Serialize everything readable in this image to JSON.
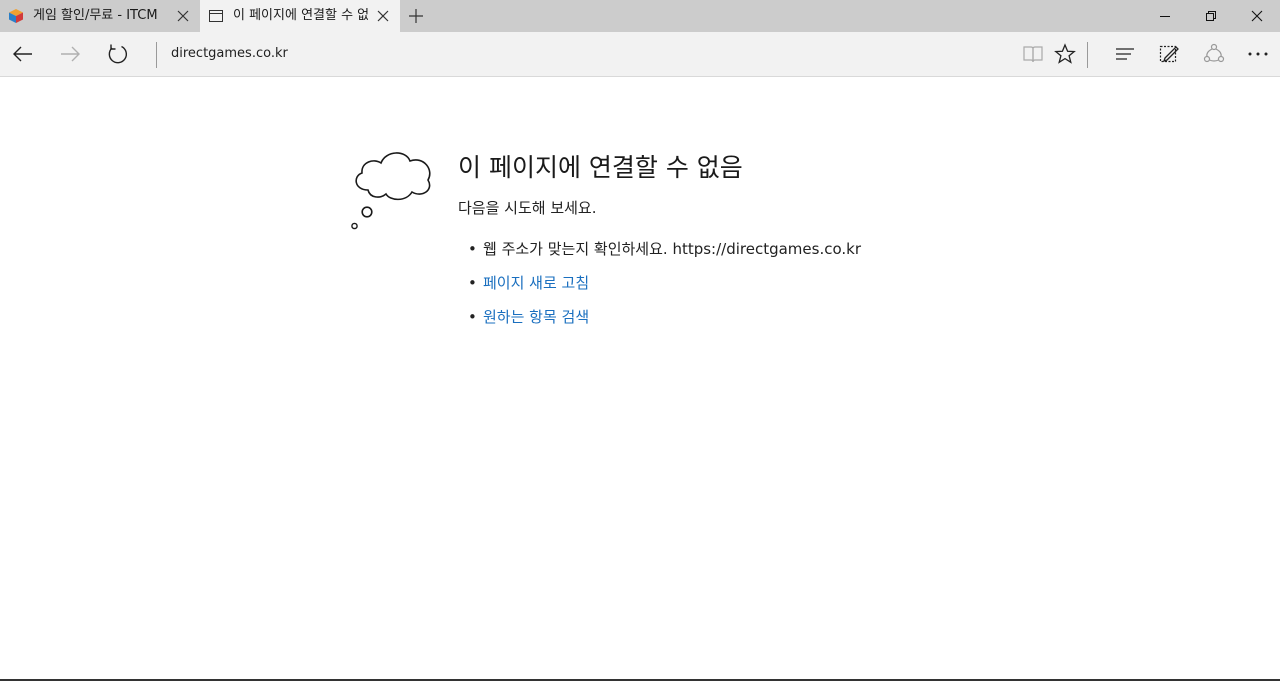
{
  "tabs": [
    {
      "title": "게임 할인/무료 - ITCM",
      "active": false
    },
    {
      "title": "이 페이지에 연결할 수 없음",
      "active": true
    }
  ],
  "address_bar": {
    "url": "directgames.co.kr"
  },
  "toolbar": {
    "icons": [
      "back-icon",
      "forward-icon",
      "refresh-icon",
      "reading-view-icon",
      "favorite-star-icon",
      "hub-icon",
      "web-note-icon",
      "share-icon",
      "more-icon"
    ]
  },
  "error_page": {
    "title": "이 페이지에 연결할 수 없음",
    "subtitle": "다음을 시도해 보세요.",
    "suggestions": [
      {
        "text": "웹 주소가 맞는지 확인하세요. https://directgames.co.kr",
        "link": false
      },
      {
        "text": "페이지 새로 고침",
        "link": true
      },
      {
        "text": "원하는 항목 검색",
        "link": true
      }
    ]
  },
  "colors": {
    "tabstrip": "#cccccc",
    "active_tab": "#f2f2f2",
    "link": "#1a6fbf",
    "text": "#222222"
  }
}
